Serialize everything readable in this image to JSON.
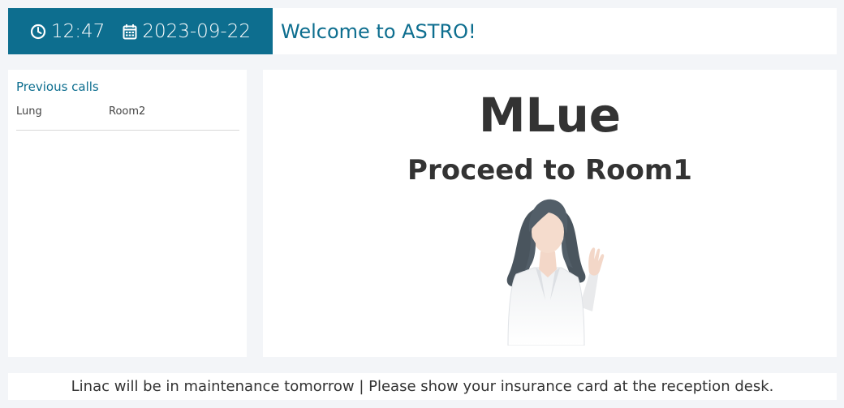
{
  "header": {
    "time": "12:47",
    "date": "2023-09-22",
    "time_icon": "clock-icon",
    "date_icon": "calendar-icon",
    "welcome": "Welcome to ASTRO!"
  },
  "previous_calls": {
    "title": "Previous calls",
    "items": [
      {
        "group": "Lung",
        "room": "Room2"
      }
    ]
  },
  "current_call": {
    "patient": "MLue",
    "instruction": "Proceed to Room1",
    "illustration": "waving-staff-illustration"
  },
  "footer": {
    "ticker": "Linac will be in maintenance tomorrow | Please show your insurance card at the reception desk."
  },
  "colors": {
    "accent": "#0d6e8f",
    "background": "#f3f5f8",
    "text": "#333333"
  }
}
